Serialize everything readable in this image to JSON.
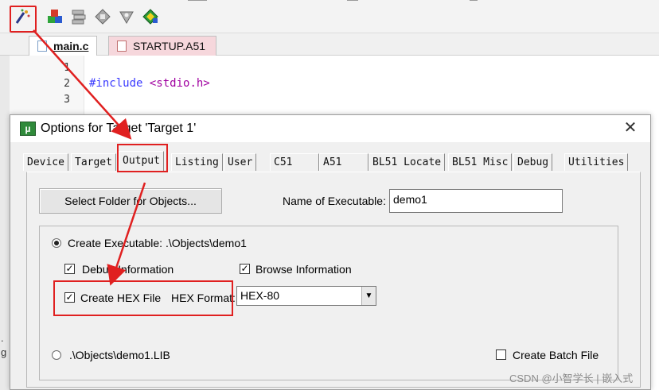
{
  "toolbar": {
    "icons": [
      "magic-wand-build-icon",
      "options-components-icon",
      "manage-books-icon",
      "pack-installer-icon",
      "target-options-icon",
      "select-device-icon"
    ]
  },
  "editor": {
    "tabs": [
      {
        "label": "main.c",
        "active": true
      },
      {
        "label": "STARTUP.A51",
        "active": false
      }
    ],
    "lines": [
      {
        "no": "1",
        "text": ""
      },
      {
        "no": "2",
        "keyword": "#include",
        "rest": "<stdio.h>"
      },
      {
        "no": "3",
        "text": ""
      }
    ]
  },
  "dialog": {
    "title": "Options for Target 'Target 1'",
    "close_glyph": "✕",
    "tabs": [
      "Device",
      "Target",
      "Output",
      "Listing",
      "User",
      "C51",
      "A51",
      "BL51 Locate",
      "BL51 Misc",
      "Debug",
      "Utilities"
    ],
    "active_tab": "Output",
    "select_folder_button": "Select Folder for Objects...",
    "name_label": "Name of Executable:",
    "name_value": "demo1",
    "create_executable_label": "Create Executable:  .\\Objects\\demo1",
    "debug_info_label": "Debug Information",
    "browse_info_label": "Browse Information",
    "create_hex_label": "Create HEX File",
    "hex_format_label": "HEX Format:",
    "hex_format_value": "HEX-80",
    "lib_label": ".\\Objects\\demo1.LIB",
    "batch_file_label": "Create Batch File"
  },
  "colors": {
    "highlight_red": "#e02020",
    "dialog_bg": "#f0f0f0",
    "tab_inactive_bg": "#f6d7dc"
  },
  "watermark": "CSDN @小智学长 | 嵌入式"
}
